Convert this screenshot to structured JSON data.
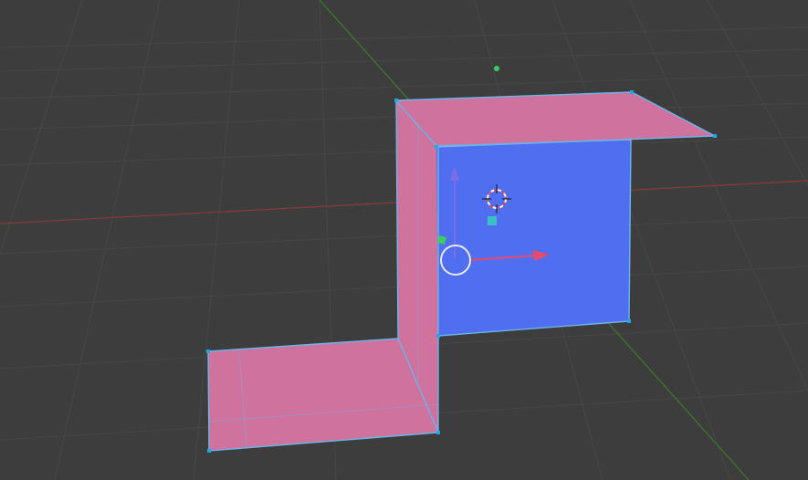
{
  "viewport": {
    "background": "#3d3d3d",
    "grid_color": "#474747",
    "x_axis_color": "#8a3a3a",
    "y_axis_color": "#3f7a2a"
  },
  "mesh": {
    "selected_face_color": "#cf729e",
    "active_face_color": "#4f6ff0",
    "edge_color": "#69b6e8",
    "vertex_color": "#1fa8e8"
  },
  "gizmo": {
    "z_arrow_color": "#7a6ee8",
    "x_arrow_color": "#e84a6a",
    "y_handle_color": "#3ccf5e",
    "center_color": "#3cc0c8",
    "rotate_ring_color": "#e8e8e8"
  },
  "cursor_3d": {
    "icon": "3d-cursor-icon",
    "ring_primary": "#ffffff",
    "ring_secondary": "#e84a4a"
  },
  "light": {
    "icon": "light-dot-icon",
    "color": "#36d060"
  }
}
